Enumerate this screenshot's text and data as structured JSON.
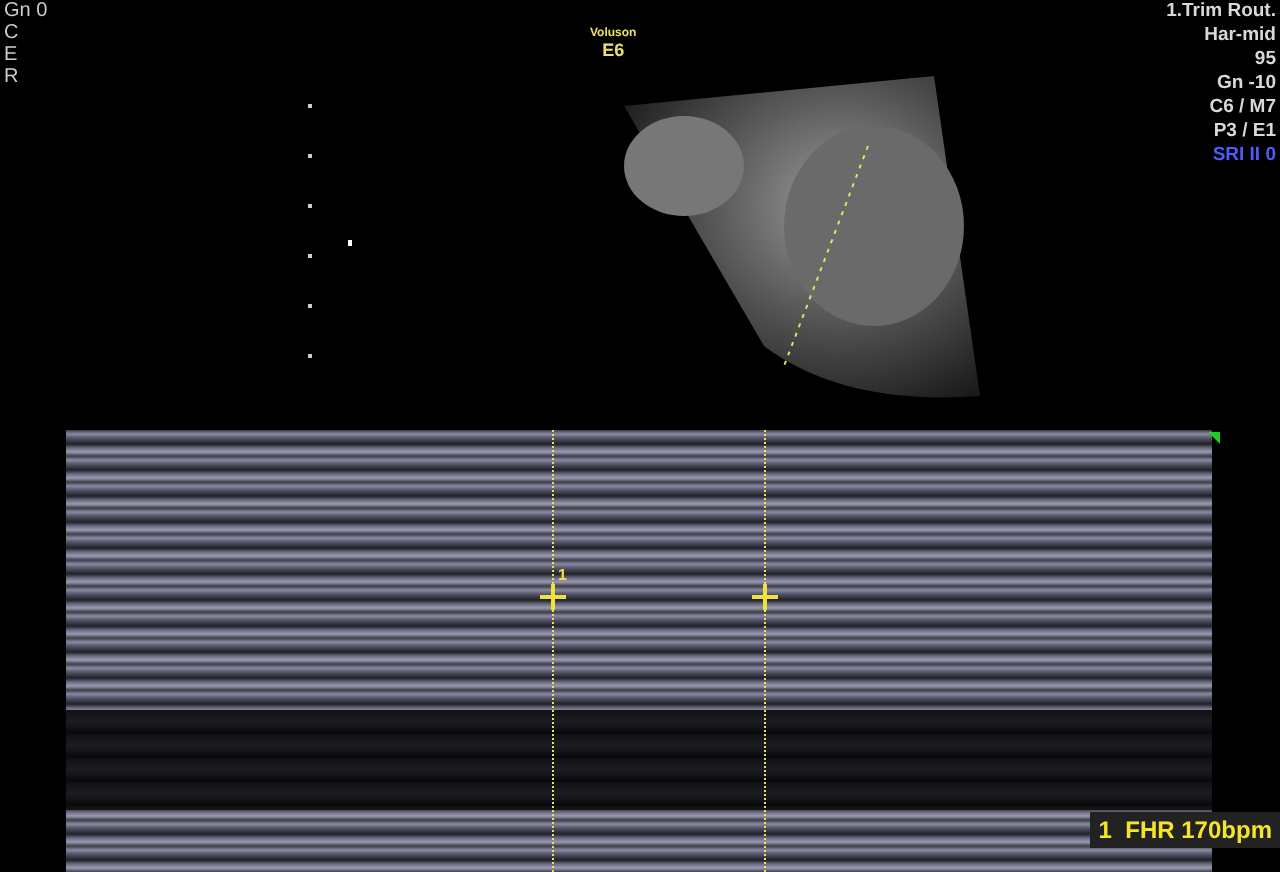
{
  "left_params": [
    "Gn 0",
    "C",
    "E",
    "R"
  ],
  "probe": {
    "brand": "Voluson",
    "model": "E6"
  },
  "right_params": [
    {
      "text": "1.Trim Rout.",
      "color": "#d8d8d8"
    },
    {
      "text": "Har-mid",
      "color": "#d8d8d8"
    },
    {
      "text": "95",
      "color": "#d8d8d8"
    },
    {
      "text": "Gn -10",
      "color": "#d8d8d8"
    },
    {
      "text": "C6 / M7",
      "color": "#d8d8d8"
    },
    {
      "text": "P3 / E1",
      "color": "#d8d8d8"
    },
    {
      "text": "SRI II 0",
      "color": "#4a5cff"
    }
  ],
  "caliper": {
    "label": "1"
  },
  "measurement": "1  FHR 170bpm"
}
